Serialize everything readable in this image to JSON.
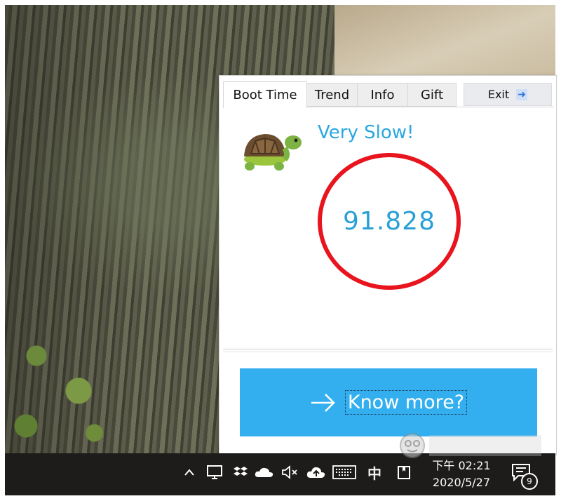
{
  "popup": {
    "tabs": [
      {
        "label": "Boot Time",
        "active": true
      },
      {
        "label": "Trend",
        "active": false
      },
      {
        "label": "Info",
        "active": false
      },
      {
        "label": "Gift",
        "active": false
      }
    ],
    "exit_label": "Exit",
    "exit_icon": "arrow-right-icon",
    "status_text": "Very Slow!",
    "boot_time": "91.828",
    "status_icon": "turtle-icon",
    "ring_color": "#e8141e",
    "accent_color": "#2aa7e0",
    "know_more_label": "Know more?",
    "know_more_icon": "arrow-right-icon",
    "button_color": "#33aff0"
  },
  "taskbar": {
    "tray_icons": [
      "chevron-up-icon",
      "network-icon",
      "dropbox-icon",
      "onedrive-icon",
      "speaker-muted-icon",
      "cloud-upload-icon",
      "keyboard-icon"
    ],
    "ime_label": "中",
    "clock_time": "下午 02:21",
    "clock_date": "2020/5/27",
    "notification_count": "9"
  }
}
